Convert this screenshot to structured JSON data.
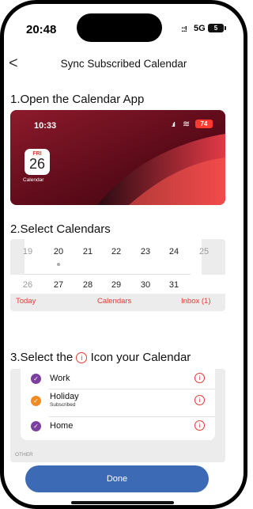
{
  "status_bar": {
    "time": "20:48",
    "signal": "::!",
    "network": "5G",
    "battery": "5"
  },
  "nav": {
    "back": "<",
    "title": "Sync Subscribed Calendar"
  },
  "steps": {
    "step1": "1.Open the Calendar App",
    "step2": "2.Select Calendars",
    "step3_prefix": "3.Select the",
    "step3_suffix": "Icon your Calendar"
  },
  "hero": {
    "time": "10:33",
    "battery": "74",
    "calendar_icon": {
      "weekday": "FRI",
      "day": "26",
      "label": "Calendar"
    }
  },
  "calendar": {
    "week1": [
      "19",
      "20",
      "21",
      "22",
      "23",
      "24",
      "25"
    ],
    "week2": [
      "26",
      "27",
      "28",
      "29",
      "30",
      "31"
    ],
    "tabs": {
      "today": "Today",
      "calendars": "Calendars",
      "inbox": "Inbox (1)"
    },
    "accent": "#e53935"
  },
  "list": {
    "items": [
      {
        "name": "Work",
        "color": "#7b3fa0"
      },
      {
        "name": "Holiday",
        "sub": "Subscribed",
        "color": "#f08a24"
      },
      {
        "name": "Home",
        "color": "#7b3fa0"
      }
    ],
    "section": "OTHER",
    "info_icon": "info-circle-icon"
  },
  "done_button": {
    "label": "Done",
    "color": "#3d6ab5"
  }
}
